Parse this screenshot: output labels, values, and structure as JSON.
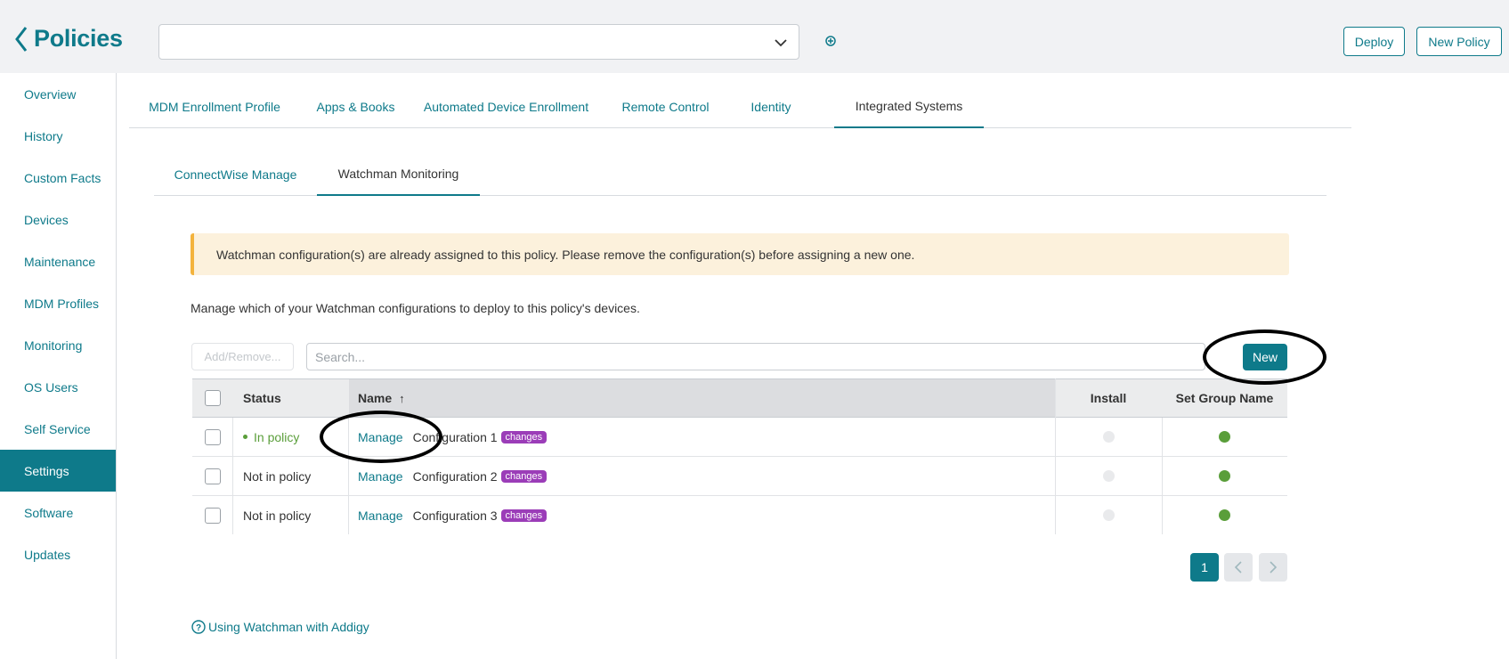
{
  "header": {
    "title": "Policies",
    "deploy_label": "Deploy",
    "new_policy_label": "New Policy"
  },
  "sidebar": {
    "items": [
      {
        "label": "Overview"
      },
      {
        "label": "History"
      },
      {
        "label": "Custom Facts"
      },
      {
        "label": "Devices"
      },
      {
        "label": "Maintenance"
      },
      {
        "label": "MDM Profiles"
      },
      {
        "label": "Monitoring"
      },
      {
        "label": "OS Users"
      },
      {
        "label": "Self Service"
      },
      {
        "label": "Settings",
        "active": true
      },
      {
        "label": "Software"
      },
      {
        "label": "Updates"
      }
    ]
  },
  "tabs": [
    {
      "label": "MDM Enrollment Profile"
    },
    {
      "label": "Apps & Books"
    },
    {
      "label": "Automated Device Enrollment"
    },
    {
      "label": "Remote Control"
    },
    {
      "label": "Identity"
    },
    {
      "label": "Integrated Systems",
      "active": true
    }
  ],
  "subtabs": [
    {
      "label": "ConnectWise Manage"
    },
    {
      "label": "Watchman Monitoring",
      "active": true
    }
  ],
  "alert": {
    "text": "Watchman configuration(s) are already assigned to this policy. Please remove the configuration(s) before assigning a new one."
  },
  "description": "Manage which of your Watchman configurations to deploy to this policy's devices.",
  "toolbar": {
    "add_remove_label": "Add/Remove...",
    "search_placeholder": "Search...",
    "new_label": "New"
  },
  "table": {
    "columns": {
      "status": "Status",
      "name": "Name",
      "sort_glyph": "↑",
      "install": "Install",
      "set_group_name": "Set Group Name"
    },
    "rows": [
      {
        "status": "In policy",
        "manage": "Manage",
        "name": "Configuration 1",
        "badge": "changes",
        "install": "off",
        "set_group_name": "on"
      },
      {
        "status": "Not in policy",
        "manage": "Manage",
        "name": "Configuration 2",
        "badge": "changes",
        "install": "off",
        "set_group_name": "on"
      },
      {
        "status": "Not in policy",
        "manage": "Manage",
        "name": "Configuration 3",
        "badge": "changes",
        "install": "off",
        "set_group_name": "on"
      }
    ]
  },
  "pagination": {
    "current_page": "1"
  },
  "help_link": "Using Watchman with Addigy",
  "colors": {
    "accent": "#0e7a8a",
    "badge": "#9b3db8",
    "status_green": "#5a9e3a",
    "alert_bg": "#fcf1dc",
    "alert_border": "#f3b33d"
  },
  "icons": [
    "chevron-left-icon",
    "chevron-down-icon",
    "add-circle-icon",
    "question-circle-icon",
    "chevron-left-page-icon",
    "chevron-right-page-icon"
  ]
}
